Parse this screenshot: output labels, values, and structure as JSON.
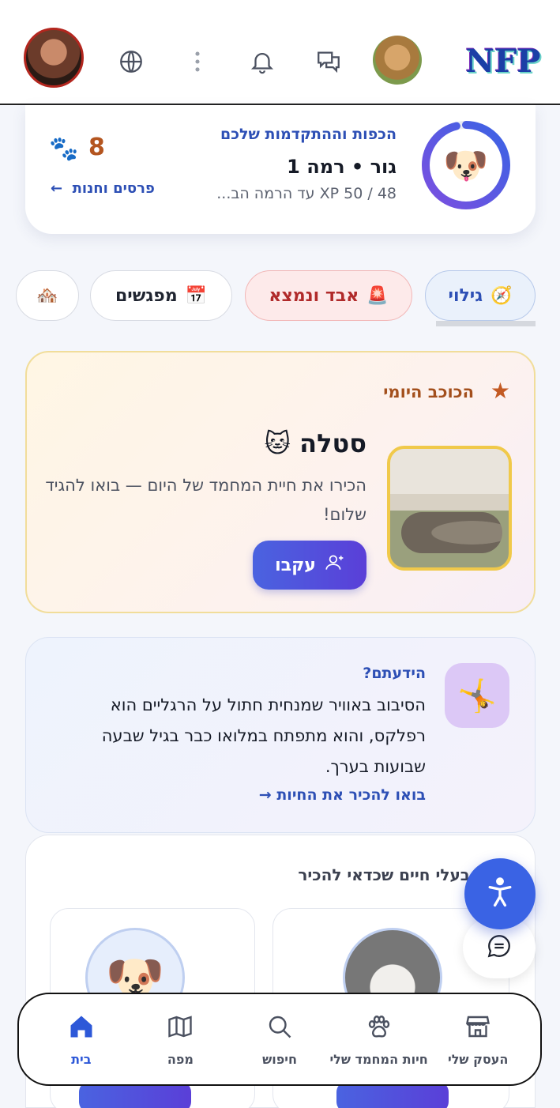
{
  "header": {
    "logo_text": "NFP",
    "icons": [
      "user-avatar",
      "globe-icon",
      "more-vertical-icon",
      "bell-icon",
      "chat-bubbles-icon",
      "pet-avatar"
    ]
  },
  "progress": {
    "title": "הכפות וההתקדמות שלכם",
    "level": "גור • רמה 1",
    "xp": "48 / 50 XP עד הרמה הב...",
    "xp_fraction": 0.96,
    "paw_count": "8",
    "rewards_link": "פרסים וחנות",
    "avatar_emoji": "🐶"
  },
  "chips": [
    {
      "label": "גילוי",
      "emoji": "🧭"
    },
    {
      "label": "אבד ונמצא",
      "emoji": "🚨"
    },
    {
      "label": "מפגשים",
      "emoji": "📅"
    },
    {
      "label": "",
      "emoji": "🏘️"
    }
  ],
  "daily_star": {
    "title": "הכוכב היומי",
    "name": "סטלה 🐱",
    "description": "הכירו את חיית המחמד של היום — בואו להגיד שלום!",
    "follow_label": "עקבו"
  },
  "fact": {
    "title": "הידעתם?",
    "text": "הסיבוב באוויר שמנחית חתול על הרגליים הוא רפלקס, והוא מתפתח במלואו כבר בגיל שבעה שבועות בערך.",
    "link": "בואו להכיר את החיות →",
    "icon_emoji": "🤸"
  },
  "suggested": {
    "title": "בעלי חיים שכדאי להכיר"
  },
  "bottom_nav": [
    {
      "label": "בית",
      "icon": "home-icon",
      "active": true
    },
    {
      "label": "מפה",
      "icon": "map-icon",
      "active": false
    },
    {
      "label": "חיפוש",
      "icon": "search-icon",
      "active": false
    },
    {
      "label": "חיות המחמד שלי",
      "icon": "paw-icon",
      "active": false
    },
    {
      "label": "העסק שלי",
      "icon": "store-icon",
      "active": false
    }
  ],
  "colors": {
    "accent": "#2d4fb5",
    "primary_button": "#4a63e0",
    "active_nav": "#2d58d8"
  }
}
